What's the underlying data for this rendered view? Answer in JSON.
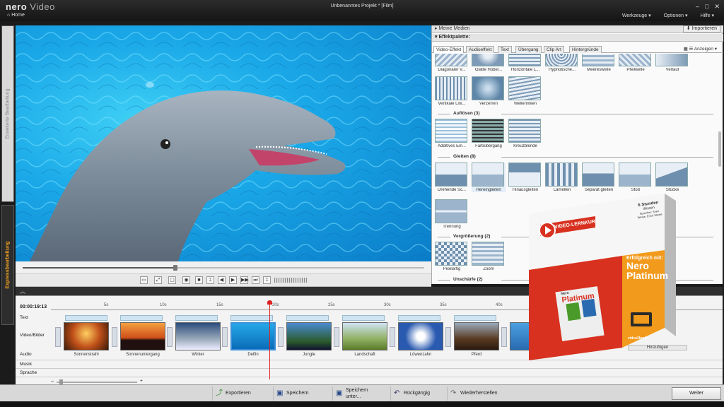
{
  "app": {
    "brand": "nero",
    "product": "Video",
    "window_title": "Unbenanntes Projekt * [Film]",
    "home": "Home"
  },
  "menu": {
    "tools": "Werkzeuge ▾",
    "options": "Optionen ▾",
    "help": "Hilfe ▾"
  },
  "left_tabs": {
    "advanced": "Erweiterte Bearbeitung",
    "express": "Expressbearbeitung"
  },
  "media": {
    "my_media": "Meine Medien",
    "effect_palette": "Effektpalette:",
    "import": "Importieren"
  },
  "tabs": [
    "Video-Effekt",
    "Audioeffekt",
    "Text",
    "Übergang",
    "Clip Art",
    "Hintergründe"
  ],
  "view_label": "Anzeigen ▾",
  "effects": {
    "row1": [
      "Diagonaler V...",
      "Glatte Hobel...",
      "Horizontale L...",
      "Hypnotische...",
      "Meereswelle",
      "Pfeilwelle",
      "Verlauf"
    ],
    "row2": [
      "Vertikale Lini...",
      "Verzerren",
      "Wellenlinien"
    ],
    "sect_dissolve": "Auflösen (3)",
    "dissolve": [
      "Additives Ein...",
      "Farbübergang",
      "Kreuzblende"
    ],
    "sect_slide": "Gleiten (8)",
    "slide": [
      "Drehende Sc...",
      "Hereingleiten",
      "Hinausgleiten",
      "Lamellen",
      "Separat gleiten",
      "Stoß",
      "Stücke"
    ],
    "slide2": [
      "Trennung"
    ],
    "sect_zoom": "Vergrößerung (2)",
    "zoom": [
      "Pixelartig",
      "Zoom"
    ],
    "sect_blur": "Unschärfe (2)"
  },
  "playback": {
    "progress": 0.38
  },
  "timeline": {
    "time": "00:00:19:13",
    "rows": [
      "Text",
      "Video/Bilder",
      "Audio",
      "Musik",
      "Sprache"
    ],
    "ticks": [
      "5s",
      "10s",
      "15s",
      "20s",
      "25s",
      "30s",
      "35s",
      "40s"
    ],
    "clips": [
      "Sonnenstrahl",
      "Sonnenuntergang",
      "Winter",
      "Delfin",
      "Jungle",
      "Landschaft",
      "Löwenzahn",
      "Pferd",
      "Riff"
    ],
    "tail_label": "Hinzufügen"
  },
  "buttons": {
    "export": "Exportieren",
    "save": "Speichern",
    "save_as": "Speichern unter...",
    "undo": "Rückgängig",
    "redo": "Wiederherstellen",
    "next": "Weiter"
  },
  "promo": {
    "badge": "VIDEO-LERNKURS",
    "hours_num": "6",
    "hours_label": "Stunden",
    "hours_sub": "Wissen",
    "authors": "Sprecher: Sven Weise, Ernst Steele",
    "tag": "Erfolgreich mit:",
    "line1": "Nero",
    "line2": "Platinum",
    "logo_text": "Platinum",
    "logo_sub": "Nero",
    "brand": "video2brain"
  },
  "colors": {
    "accent_orange": "#f0a020",
    "promo_red": "#d8311f",
    "promo_orange": "#f29a1c",
    "water": "#1aa8e8"
  }
}
